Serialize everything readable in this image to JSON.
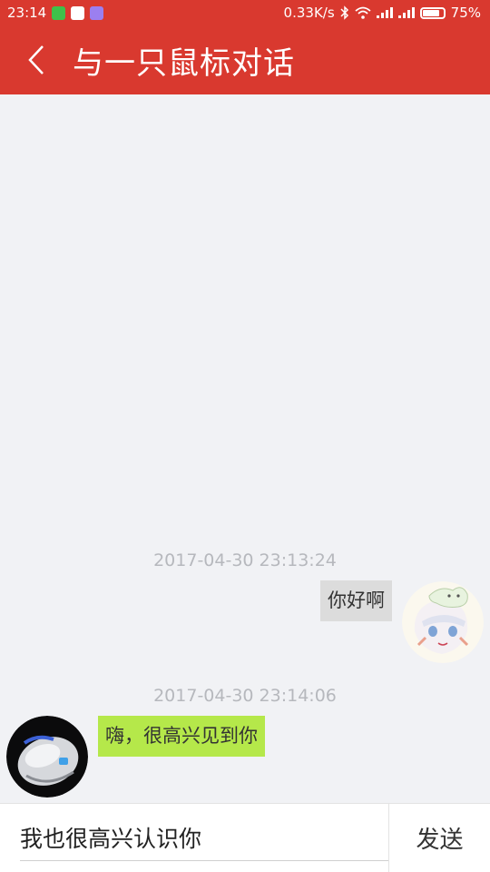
{
  "status_bar": {
    "time": "23:14",
    "network_speed": "0.33K/s",
    "battery": "75%",
    "icons": [
      "wechat-icon",
      "qq-icon",
      "app-icon",
      "bluetooth-icon",
      "wifi-icon",
      "signal-icon",
      "signal-icon",
      "battery-icon"
    ],
    "battery_level": 0.75
  },
  "toolbar": {
    "title": "与一只鼠标对话",
    "back_icon": "chevron-left-icon",
    "color": "#d9392f"
  },
  "messages": [
    {
      "timestamp": "2017-04-30 23:13:24",
      "sender": "me",
      "text": "你好啊",
      "bubble_color": "#dcdcdc"
    },
    {
      "timestamp": "2017-04-30 23:14:06",
      "sender": "mouse",
      "text": "嗨，很高兴见到你",
      "bubble_color": "#b5e84a"
    }
  ],
  "input_bar": {
    "value": "我也很高兴认识你",
    "send_label": "发送"
  }
}
